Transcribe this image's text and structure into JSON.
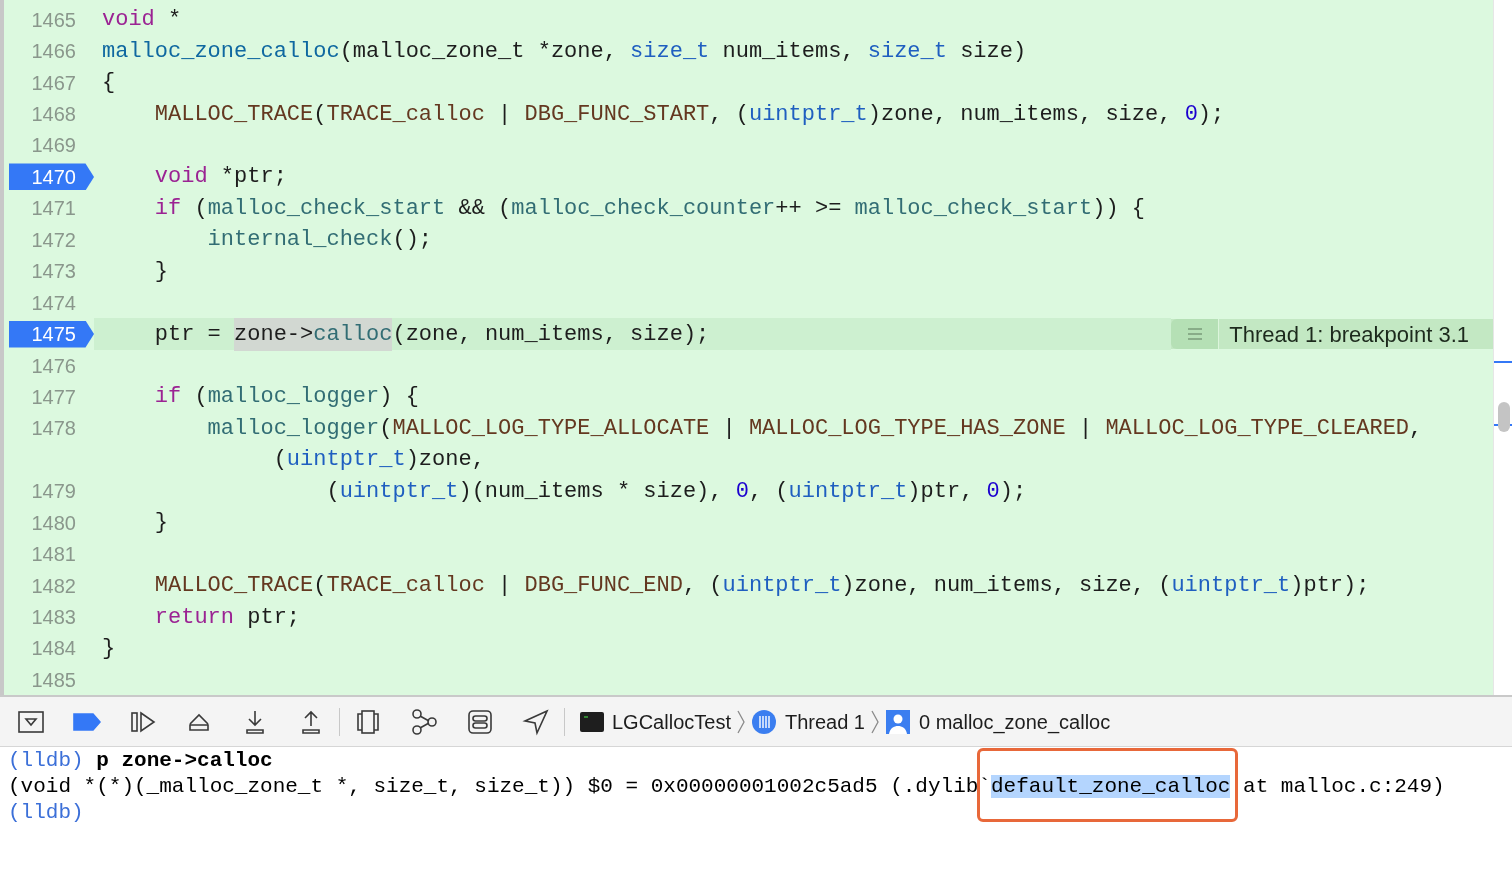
{
  "editor": {
    "lines": [
      {
        "number": "1465",
        "breakpoint": false,
        "current": false,
        "tokens": [
          {
            "text": "void",
            "kind": "keyword"
          },
          {
            "text": " *",
            "kind": "plain"
          }
        ]
      },
      {
        "number": "1466",
        "breakpoint": false,
        "current": false,
        "tokens": [
          {
            "text": "malloc_zone_calloc",
            "kind": "decl"
          },
          {
            "text": "(malloc_zone_t *zone, ",
            "kind": "plain"
          },
          {
            "text": "size_t",
            "kind": "type"
          },
          {
            "text": " num_items, ",
            "kind": "plain"
          },
          {
            "text": "size_t",
            "kind": "type"
          },
          {
            "text": " size)",
            "kind": "plain"
          }
        ]
      },
      {
        "number": "1467",
        "breakpoint": false,
        "current": false,
        "tokens": [
          {
            "text": "{",
            "kind": "plain"
          }
        ]
      },
      {
        "number": "1468",
        "breakpoint": false,
        "current": false,
        "tokens": [
          {
            "text": "    MALLOC_TRACE",
            "kind": "macro"
          },
          {
            "text": "(",
            "kind": "plain"
          },
          {
            "text": "TRACE_calloc",
            "kind": "macro"
          },
          {
            "text": " | ",
            "kind": "plain"
          },
          {
            "text": "DBG_FUNC_START",
            "kind": "macro"
          },
          {
            "text": ", (",
            "kind": "plain"
          },
          {
            "text": "uintptr_t",
            "kind": "type"
          },
          {
            "text": ")zone, num_items, size, ",
            "kind": "plain"
          },
          {
            "text": "0",
            "kind": "number"
          },
          {
            "text": ");",
            "kind": "plain"
          }
        ]
      },
      {
        "number": "1469",
        "breakpoint": false,
        "current": false
      },
      {
        "number": "1470",
        "breakpoint": true,
        "current": false,
        "tokens": [
          {
            "text": "    void",
            "kind": "keyword"
          },
          {
            "text": " *ptr;",
            "kind": "plain"
          }
        ]
      },
      {
        "number": "1471",
        "breakpoint": false,
        "current": false,
        "tokens": [
          {
            "text": "    if",
            "kind": "keyword"
          },
          {
            "text": " (",
            "kind": "plain"
          },
          {
            "text": "malloc_check_start",
            "kind": "func"
          },
          {
            "text": " && (",
            "kind": "plain"
          },
          {
            "text": "malloc_check_counter",
            "kind": "func"
          },
          {
            "text": "++ >= ",
            "kind": "plain"
          },
          {
            "text": "malloc_check_start",
            "kind": "func"
          },
          {
            "text": ")) {",
            "kind": "plain"
          }
        ]
      },
      {
        "number": "1472",
        "breakpoint": false,
        "current": false,
        "tokens": [
          {
            "text": "        internal_check",
            "kind": "func"
          },
          {
            "text": "();",
            "kind": "plain"
          }
        ]
      },
      {
        "number": "1473",
        "breakpoint": false,
        "current": false,
        "tokens": [
          {
            "text": "    }",
            "kind": "plain"
          }
        ]
      },
      {
        "number": "1474",
        "breakpoint": false,
        "current": false
      },
      {
        "number": "1475",
        "breakpoint": true,
        "current": true,
        "annotation": "Thread 1: breakpoint 3.1",
        "tokens": [
          {
            "text": "    ptr = ",
            "kind": "plain"
          },
          {
            "text": "zone->",
            "kind": "plain",
            "highlighted": true
          },
          {
            "text": "calloc",
            "kind": "func",
            "highlighted": true
          },
          {
            "text": "(zone, num_items, size);",
            "kind": "plain"
          }
        ]
      },
      {
        "number": "1476",
        "breakpoint": false,
        "current": false
      },
      {
        "number": "1477",
        "breakpoint": false,
        "current": false,
        "tokens": [
          {
            "text": "    if",
            "kind": "keyword"
          },
          {
            "text": " (",
            "kind": "plain"
          },
          {
            "text": "malloc_logger",
            "kind": "func"
          },
          {
            "text": ") {",
            "kind": "plain"
          }
        ]
      },
      {
        "number": "1478",
        "breakpoint": false,
        "current": false,
        "tokens": [
          {
            "text": "        malloc_logger",
            "kind": "func"
          },
          {
            "text": "(",
            "kind": "plain"
          },
          {
            "text": "MALLOC_LOG_TYPE_ALLOCATE",
            "kind": "macro"
          },
          {
            "text": " | ",
            "kind": "plain"
          },
          {
            "text": "MALLOC_LOG_TYPE_HAS_ZONE",
            "kind": "macro"
          },
          {
            "text": " | ",
            "kind": "plain"
          },
          {
            "text": "MALLOC_LOG_TYPE_CLEARED",
            "kind": "macro"
          },
          {
            "text": ",",
            "kind": "plain"
          }
        ]
      },
      {
        "tokens": [
          {
            "text": "             (",
            "kind": "plain"
          },
          {
            "text": "uintptr_t",
            "kind": "type"
          },
          {
            "text": ")zone,",
            "kind": "plain"
          }
        ]
      },
      {
        "number": "1479",
        "breakpoint": false,
        "current": false,
        "tokens": [
          {
            "text": "                 (",
            "kind": "plain"
          },
          {
            "text": "uintptr_t",
            "kind": "type"
          },
          {
            "text": ")(num_items * size), ",
            "kind": "plain"
          },
          {
            "text": "0",
            "kind": "number"
          },
          {
            "text": ", (",
            "kind": "plain"
          },
          {
            "text": "uintptr_t",
            "kind": "type"
          },
          {
            "text": ")ptr, ",
            "kind": "plain"
          },
          {
            "text": "0",
            "kind": "number"
          },
          {
            "text": ");",
            "kind": "plain"
          }
        ]
      },
      {
        "number": "1480",
        "breakpoint": false,
        "current": false,
        "tokens": [
          {
            "text": "    }",
            "kind": "plain"
          }
        ]
      },
      {
        "number": "1481",
        "breakpoint": false,
        "current": false
      },
      {
        "number": "1482",
        "breakpoint": false,
        "current": false,
        "tokens": [
          {
            "text": "    MALLOC_TRACE",
            "kind": "macro"
          },
          {
            "text": "(",
            "kind": "plain"
          },
          {
            "text": "TRACE_calloc",
            "kind": "macro"
          },
          {
            "text": " | ",
            "kind": "plain"
          },
          {
            "text": "DBG_FUNC_END",
            "kind": "macro"
          },
          {
            "text": ", (",
            "kind": "plain"
          },
          {
            "text": "uintptr_t",
            "kind": "type"
          },
          {
            "text": ")zone, num_items, size, (",
            "kind": "plain"
          },
          {
            "text": "uintptr_t",
            "kind": "type"
          },
          {
            "text": ")ptr);",
            "kind": "plain"
          }
        ]
      },
      {
        "number": "1483",
        "breakpoint": false,
        "current": false,
        "tokens": [
          {
            "text": "    return",
            "kind": "keyword"
          },
          {
            "text": " ptr;",
            "kind": "plain"
          }
        ]
      },
      {
        "number": "1484",
        "breakpoint": false,
        "current": false,
        "tokens": [
          {
            "text": "}",
            "kind": "plain"
          }
        ]
      },
      {
        "number": "1485",
        "breakpoint": false,
        "current": false
      }
    ]
  },
  "debug_bar": {
    "breakpoints_active": true,
    "breadcrumbs": [
      {
        "kind": "target",
        "label": "LGCallocTest"
      },
      {
        "kind": "thread",
        "label": "Thread 1"
      },
      {
        "kind": "frame",
        "label": "0 malloc_zone_calloc"
      }
    ]
  },
  "console": {
    "lines": [
      {
        "prompt": "(lldb)",
        "command": "p zone->calloc"
      },
      {
        "text": "(void *(*)(_malloc_zone_t *, size_t, size_t)) $0 = 0x00000001002c5ad5 (.dylib`",
        "selection": "default_zone_calloc",
        "after": " at malloc.c:249)"
      },
      {
        "prompt": "(lldb)"
      }
    ]
  }
}
